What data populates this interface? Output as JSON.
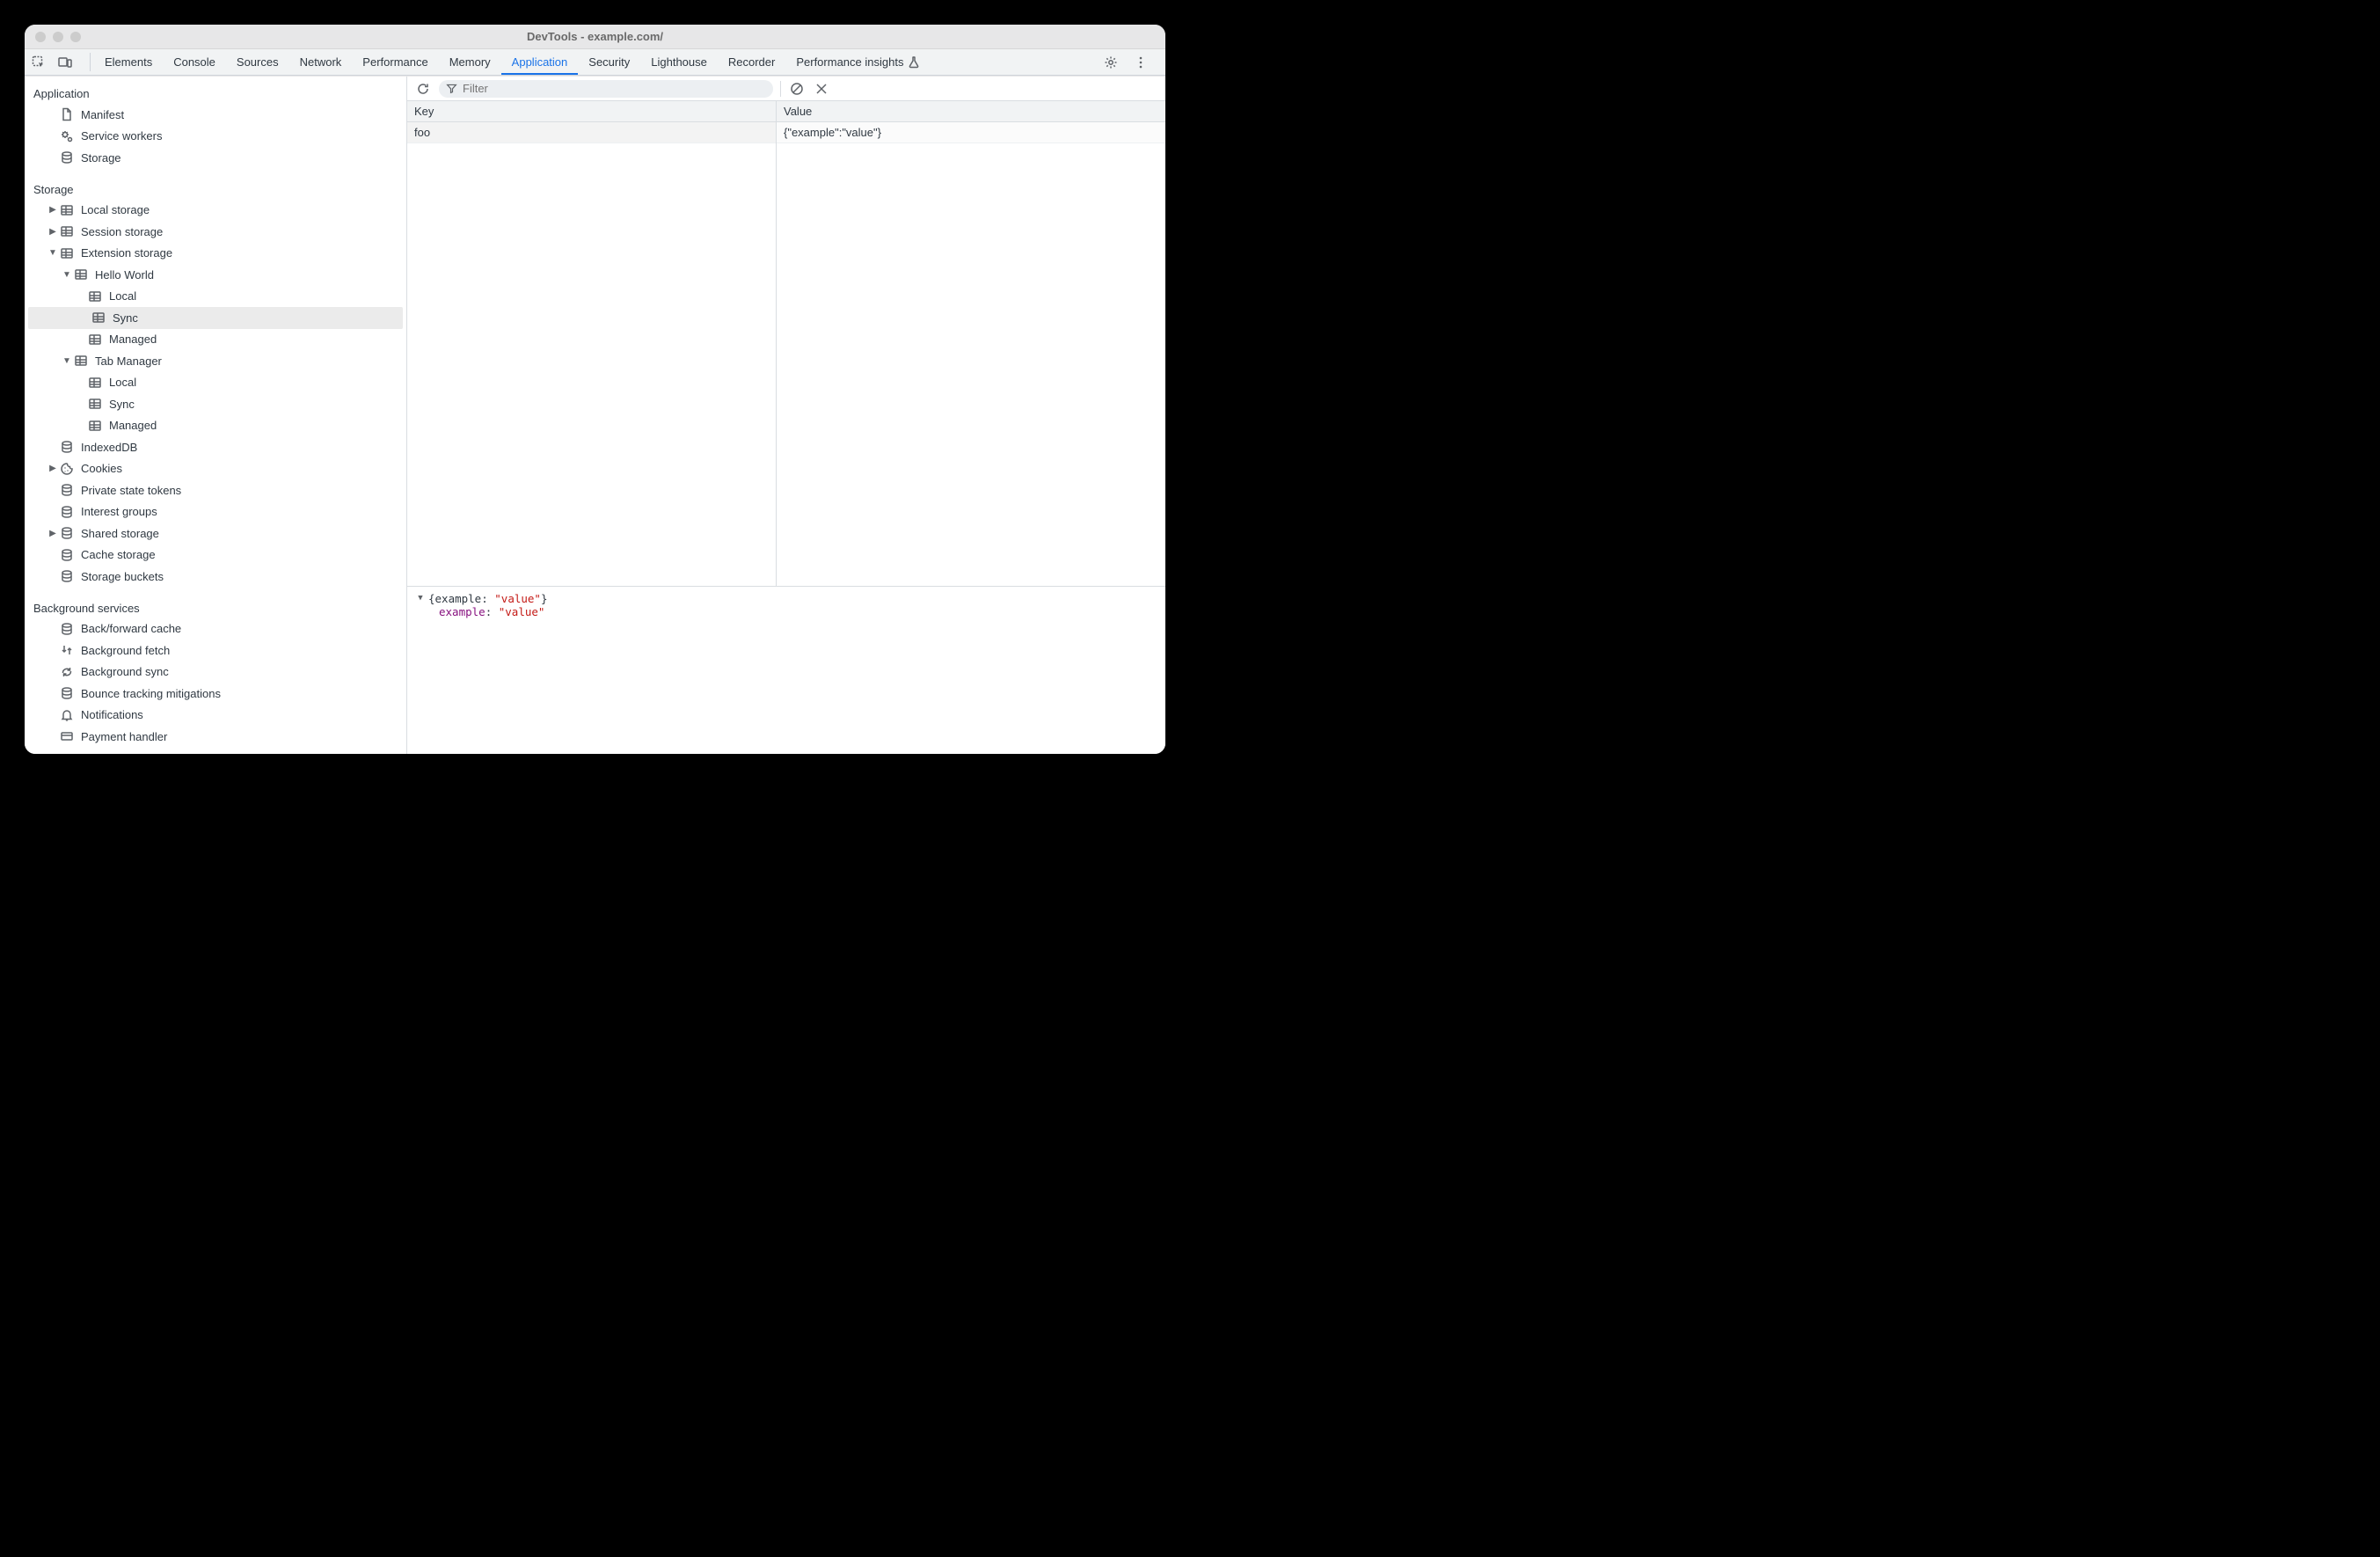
{
  "window": {
    "title": "DevTools - example.com/"
  },
  "tabs": {
    "items": [
      {
        "label": "Elements",
        "active": false
      },
      {
        "label": "Console",
        "active": false
      },
      {
        "label": "Sources",
        "active": false
      },
      {
        "label": "Network",
        "active": false
      },
      {
        "label": "Performance",
        "active": false
      },
      {
        "label": "Memory",
        "active": false
      },
      {
        "label": "Application",
        "active": true
      },
      {
        "label": "Security",
        "active": false
      },
      {
        "label": "Lighthouse",
        "active": false
      },
      {
        "label": "Recorder",
        "active": false
      },
      {
        "label": "Performance insights",
        "active": false,
        "icon": "flask"
      }
    ]
  },
  "sidebar": {
    "sections": [
      {
        "title": "Application",
        "items": [
          {
            "label": "Manifest",
            "icon": "document",
            "indent": 1
          },
          {
            "label": "Service workers",
            "icon": "gears",
            "indent": 1
          },
          {
            "label": "Storage",
            "icon": "database",
            "indent": 1
          }
        ]
      },
      {
        "title": "Storage",
        "items": [
          {
            "label": "Local storage",
            "icon": "table",
            "indent": 1,
            "arrow": "right"
          },
          {
            "label": "Session storage",
            "icon": "table",
            "indent": 1,
            "arrow": "right"
          },
          {
            "label": "Extension storage",
            "icon": "table",
            "indent": 1,
            "arrow": "down"
          },
          {
            "label": "Hello World",
            "icon": "table",
            "indent": 2,
            "arrow": "down"
          },
          {
            "label": "Local",
            "icon": "table",
            "indent": 3
          },
          {
            "label": "Sync",
            "icon": "table",
            "indent": 3,
            "selected": true
          },
          {
            "label": "Managed",
            "icon": "table",
            "indent": 3
          },
          {
            "label": "Tab Manager",
            "icon": "table",
            "indent": 2,
            "arrow": "down"
          },
          {
            "label": "Local",
            "icon": "table",
            "indent": 3
          },
          {
            "label": "Sync",
            "icon": "table",
            "indent": 3
          },
          {
            "label": "Managed",
            "icon": "table",
            "indent": 3
          },
          {
            "label": "IndexedDB",
            "icon": "database",
            "indent": 1
          },
          {
            "label": "Cookies",
            "icon": "cookie",
            "indent": 1,
            "arrow": "right"
          },
          {
            "label": "Private state tokens",
            "icon": "database",
            "indent": 1
          },
          {
            "label": "Interest groups",
            "icon": "database",
            "indent": 1
          },
          {
            "label": "Shared storage",
            "icon": "database",
            "indent": 1,
            "arrow": "right"
          },
          {
            "label": "Cache storage",
            "icon": "database",
            "indent": 1
          },
          {
            "label": "Storage buckets",
            "icon": "database",
            "indent": 1
          }
        ]
      },
      {
        "title": "Background services",
        "items": [
          {
            "label": "Back/forward cache",
            "icon": "database",
            "indent": 1
          },
          {
            "label": "Background fetch",
            "icon": "transfer",
            "indent": 1
          },
          {
            "label": "Background sync",
            "icon": "sync",
            "indent": 1
          },
          {
            "label": "Bounce tracking mitigations",
            "icon": "database",
            "indent": 1
          },
          {
            "label": "Notifications",
            "icon": "bell",
            "indent": 1
          },
          {
            "label": "Payment handler",
            "icon": "card",
            "indent": 1
          }
        ]
      }
    ]
  },
  "toolbar": {
    "filter_placeholder": "Filter"
  },
  "table": {
    "headers": {
      "key": "Key",
      "value": "Value"
    },
    "rows": [
      {
        "key": "foo",
        "value": "{\"example\":\"value\"}"
      }
    ]
  },
  "detail": {
    "summary_prefix": "{",
    "summary_key": "example",
    "summary_sep": ": ",
    "summary_val": "\"value\"",
    "summary_suffix": "}",
    "prop_key": "example",
    "prop_sep": ": ",
    "prop_val": "\"value\""
  }
}
